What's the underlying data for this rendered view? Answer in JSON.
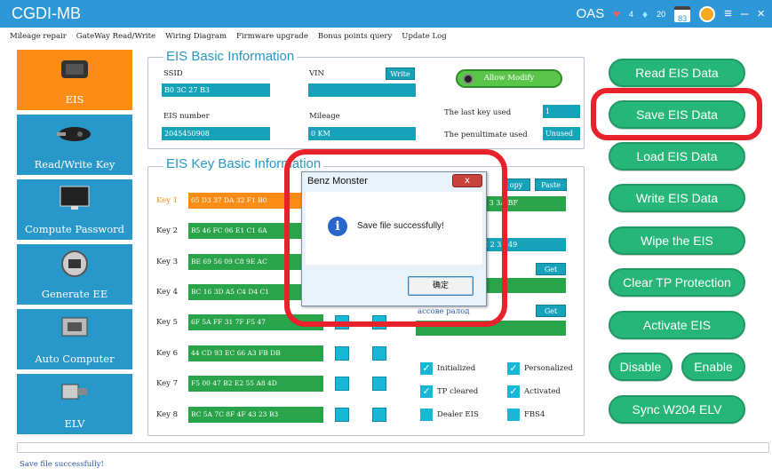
{
  "app": {
    "title": "CGDI-MB"
  },
  "titlebar": {
    "oas": "OAS",
    "hearts": "4",
    "gems": "20",
    "calendar": "83",
    "minimize": "–",
    "close": "×",
    "menu": "≡"
  },
  "menu": [
    "Mileage repair",
    "GateWay Read/Write",
    "Wiring Diagram",
    "Firmware upgrade",
    "Bonus points query",
    "Update Log"
  ],
  "sidebar": [
    {
      "label": "EIS",
      "icon": "eis-module-icon",
      "active": true
    },
    {
      "label": "Read/Write Key",
      "icon": "car-key-icon"
    },
    {
      "label": "Compute Password",
      "icon": "monitor-icon"
    },
    {
      "label": "Generate EE",
      "icon": "chip-disc-icon"
    },
    {
      "label": "Auto Computer",
      "icon": "ecu-icon"
    },
    {
      "label": "ELV",
      "icon": "elv-lock-icon"
    }
  ],
  "eis_basic": {
    "legend": "EIS Basic Information",
    "ssid_label": "SSID",
    "ssid_value": "B0 3C 27 B3",
    "vin_label": "VIN",
    "vin_value": "",
    "write_label": "Write",
    "allow_modify": "Allow Modify",
    "eis_number_label": "EIS number",
    "eis_number_value": "2045450908",
    "mileage_label": "Mileage",
    "mileage_value": "0  KM",
    "last_key_label": "The last key used",
    "last_key_value": "1",
    "penultimate_label": "The penultimate used",
    "penultimate_value": "Unused"
  },
  "eis_keys": {
    "legend": "EIS Key Basic Information",
    "copy_label": "opy",
    "paste_label": "Paste",
    "right_field_1": "8  3  3A  BF",
    "right_field_2": "C  2  33  49",
    "get_label_1": "Get",
    "get_label_2": "Get",
    "partial_label": "ассове ралод",
    "rows": [
      {
        "label": "Key 1",
        "value": "05  D3  37  DA  32  F1  B0",
        "highlight": true
      },
      {
        "label": "Key 2",
        "value": "B5  46  FC  06  E1  C1  6A"
      },
      {
        "label": "Key 3",
        "value": "BE  69  56  09  C8  9E  AC"
      },
      {
        "label": "Key 4",
        "value": "BC  16  3D  A5  C4  D4  C1"
      },
      {
        "label": "Key 5",
        "value": "6F  5A  FF  31  7F  F5  47"
      },
      {
        "label": "Key 6",
        "value": "44  CD  93  EC  66  A3  FB  DB"
      },
      {
        "label": "Key 7",
        "value": "F5  00  47  B2  E2  55  A8  4D"
      },
      {
        "label": "Key 8",
        "value": "BC  5A  7C  8F  4F  43  23  B3"
      }
    ],
    "checks": [
      {
        "label": "Initialized",
        "checked": true
      },
      {
        "label": "Personalized",
        "checked": true
      },
      {
        "label": "TP cleared",
        "checked": true
      },
      {
        "label": "Activated",
        "checked": true
      },
      {
        "label": "Dealer EIS",
        "checked": false
      },
      {
        "label": "FBS4",
        "checked": false
      }
    ]
  },
  "actions": {
    "read": "Read  EIS Data",
    "save": "Save EIS Data",
    "load": "Load EIS Data",
    "write": "Write EIS Data",
    "wipe": "Wipe the EIS",
    "clear_tp": "Clear TP Protection",
    "activate": "Activate EIS",
    "disable": "Disable",
    "enable": "Enable",
    "sync": "Sync W204 ELV"
  },
  "dialog": {
    "title": "Benz Monster",
    "message": "Save file successfully!",
    "ok": "确定",
    "close": "x"
  },
  "status": {
    "text": "Save file successfully!"
  },
  "colors": {
    "accent": "#2d97d8",
    "active": "#fb8c16",
    "button": "#27b679",
    "highlight": "#e8212b"
  }
}
